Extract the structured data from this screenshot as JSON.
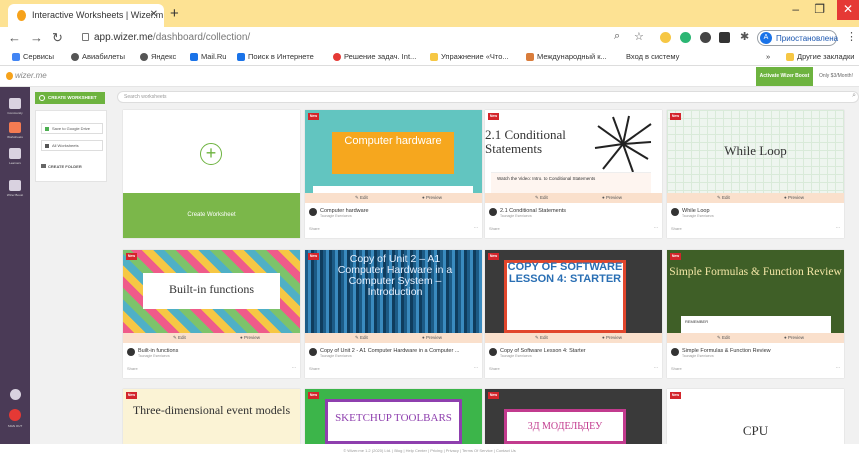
{
  "browser": {
    "tab_title": "Interactive Worksheets | Wizer.m",
    "tab_close": "✕",
    "new_tab": "+",
    "url_host": "app.wizer.me",
    "url_path": "/dashboard/collection/",
    "profile_initial": "A",
    "profile_label": "Приостановлена",
    "window_controls": [
      "–",
      "❐",
      "✕"
    ]
  },
  "bookmarks": {
    "items": [
      "Сервисы",
      "Авиабилеты",
      "Яндекс",
      "Mail.Ru",
      "Поиск в Интернете",
      "Решение задач. Int...",
      "Упражнение «Что...",
      "Международный к...",
      "Вход в систему"
    ],
    "overflow": "»",
    "other": "Другие закладки"
  },
  "app": {
    "logo_text": "wizer.me",
    "activate_label": "Activate Wizer Boost",
    "price_label": "Only $3/Month!",
    "create_worksheet_btn": "CREATE WORKSHEET",
    "search_placeholder": "Search worksheets",
    "save_to_drive": "Save to Google Drive",
    "all_worksheets": "All Worksheets",
    "create_folder": "CREATE FOLDER",
    "sidebar": [
      "Community",
      "Worksheets",
      "Learners",
      "Wizer Boost"
    ],
    "sidebar_bottom_label": "SIGN OUT",
    "create_card_label": "Create Worksheet",
    "new_badge": "New",
    "edit_label": "Edit",
    "preview_label": "Preview",
    "share_label": "Share",
    "more_label": "...",
    "author": "Taunagie Eseniaeva"
  },
  "cards": [
    {
      "slide_title": "Computer hardware",
      "title": "Computer hardware"
    },
    {
      "slide_title": "2.1 Conditional Statements",
      "slide_sub": "Watch the Video: Intro. to Conditional Statements",
      "title": "2.1 Conditional Statements"
    },
    {
      "slide_title": "While Loop",
      "title": "While Loop"
    },
    {
      "slide_title": "Built-in functions",
      "title": "Built-in functions"
    },
    {
      "slide_title": "Copy of Unit 2 – A1 Computer Hardware in a Computer System – Introduction",
      "title": "Copy of Unit 2 - A1 Computer Hardware in a Computer ..."
    },
    {
      "slide_title": "COPY OF SOFTWARE LESSON 4: STARTER",
      "title": "Copy of Software Lesson 4: Starter"
    },
    {
      "slide_title": "Simple Formulas & Function Review",
      "slide_sub": "REMEMBER",
      "title": "Simple Formulas & Function Review"
    },
    {
      "slide_title": "Three-dimensional event models",
      "title": ""
    },
    {
      "slide_title": "SKETCHUP TOOLBARS",
      "title": ""
    },
    {
      "slide_title": "3Д МОДЕЛЬДЕУ",
      "title": ""
    },
    {
      "slide_title": "CPU",
      "title": ""
    }
  ],
  "footer": "© Wizer.me 1.2 (2020) Ltd.  |  Blog  |  Help Center  |  Pricing  |  Privacy  |  Terms Of Service  |  Contact Us"
}
